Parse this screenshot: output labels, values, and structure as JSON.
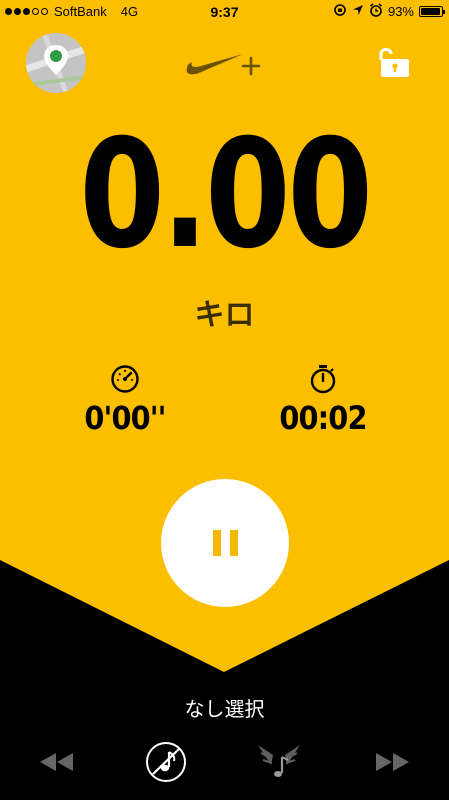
{
  "status_bar": {
    "carrier": "SoftBank",
    "network": "4G",
    "time": "9:37",
    "battery": "93%"
  },
  "run": {
    "distance": "0.00",
    "distance_unit": "キロ",
    "pace": "0'00''",
    "duration": "00:02"
  },
  "music": {
    "label": "なし選択"
  },
  "icons": {
    "map": "map-pin-icon",
    "logo": "nike-plus-logo",
    "lock": "unlock-icon",
    "pace": "speedometer-icon",
    "duration": "stopwatch-icon",
    "pause": "pause-icon",
    "rewind": "rewind-icon",
    "music": "music-off-icon",
    "powersong": "powersong-icon",
    "forward": "fast-forward-icon"
  },
  "colors": {
    "accent": "#f9be00",
    "background_bottom": "#000000",
    "logo": "#6b5300"
  }
}
